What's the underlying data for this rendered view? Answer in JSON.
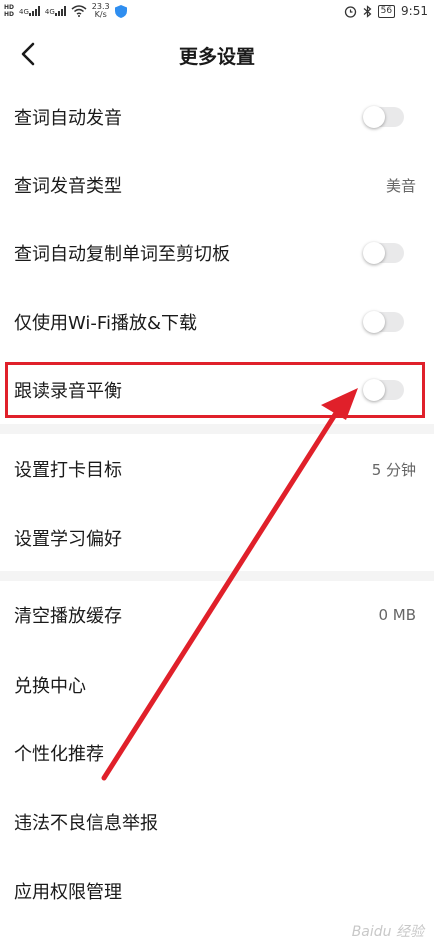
{
  "status_bar": {
    "network_top": "HD",
    "network_bottom": "HD",
    "signal1": "4G",
    "signal2": "4G",
    "speed_value": "23.3",
    "speed_unit": "K/s",
    "battery": "56",
    "time": "9:51"
  },
  "header": {
    "title": "更多设置"
  },
  "settings": {
    "auto_pronounce": {
      "label": "查词自动发音",
      "on": false
    },
    "pronounce_type": {
      "label": "查词发音类型",
      "value": "美音"
    },
    "auto_copy": {
      "label": "查词自动复制单词至剪切板",
      "on": false
    },
    "wifi_only": {
      "label": "仅使用Wi-Fi播放&下载",
      "on": false
    },
    "read_balance": {
      "label": "跟读录音平衡",
      "on": false
    },
    "checkin_goal": {
      "label": "设置打卡目标",
      "value": "5 分钟"
    },
    "learning_pref": {
      "label": "设置学习偏好"
    },
    "clear_cache": {
      "label": "清空播放缓存",
      "value": "0 MB"
    },
    "redeem_center": {
      "label": "兑换中心"
    },
    "personalized": {
      "label": "个性化推荐"
    },
    "report": {
      "label": "违法不良信息举报"
    },
    "permissions": {
      "label": "应用权限管理"
    }
  },
  "annotation": {
    "color": "#e0202a"
  },
  "watermark": "Baidu 经验"
}
